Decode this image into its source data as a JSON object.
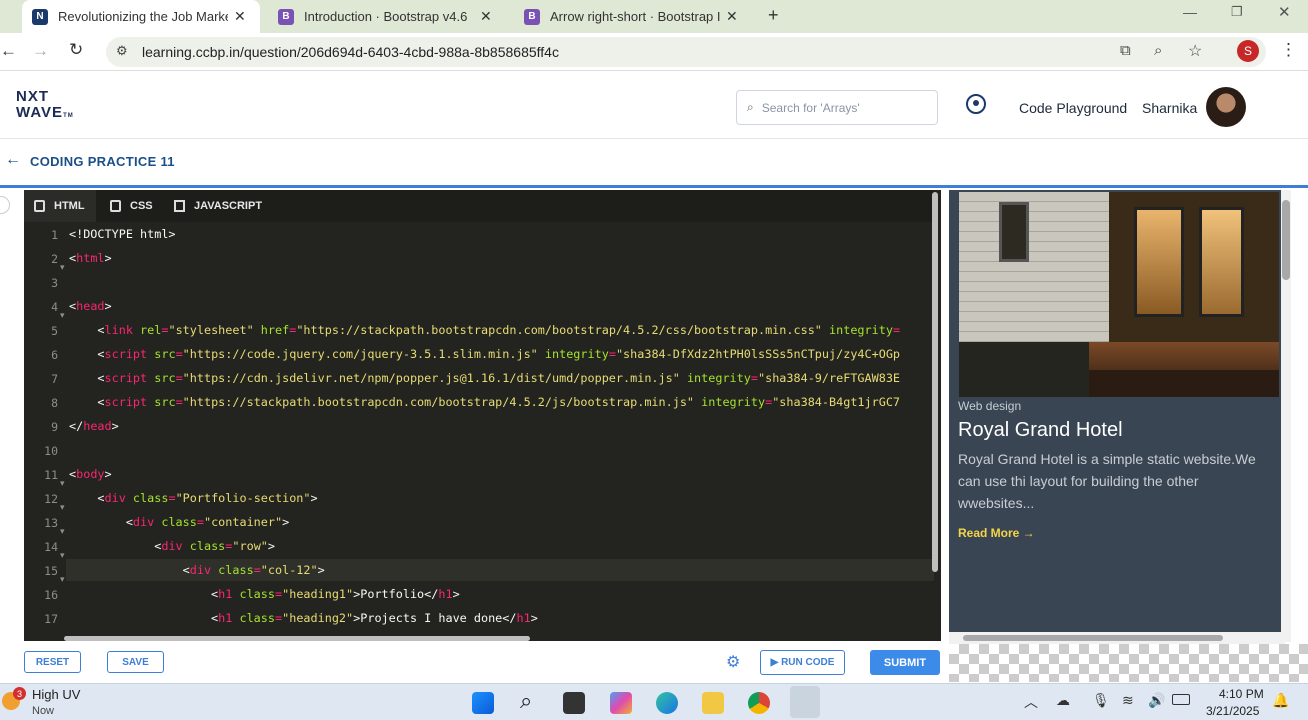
{
  "browser": {
    "tabs": [
      {
        "title": "Revolutionizing the Job Market",
        "active": true
      },
      {
        "title": "Introduction · Bootstrap v4.6",
        "active": false
      },
      {
        "title": "Arrow right-short · Bootstrap Ic",
        "active": false
      }
    ],
    "url": "learning.ccbp.in/question/206d694d-6403-4cbd-988a-8b858685ff4c",
    "profile_initial": "S"
  },
  "site": {
    "logo_line1": "NXT",
    "logo_line2": "WAVE",
    "logo_tm": "TM",
    "search_placeholder": "Search for 'Arrays'",
    "code_playground": "Code Playground",
    "username": "Sharnika"
  },
  "practice": {
    "title": "CODING PRACTICE 11"
  },
  "editor": {
    "tabs": [
      {
        "label": "HTML",
        "active": true
      },
      {
        "label": "CSS",
        "active": false
      },
      {
        "label": "JAVASCRIPT",
        "active": false
      }
    ],
    "line_numbers": [
      "1",
      "2",
      "3",
      "4",
      "5",
      "6",
      "7",
      "8",
      "9",
      "10",
      "11",
      "12",
      "13",
      "14",
      "15",
      "16",
      "17"
    ],
    "lines": {
      "l1": "<!DOCTYPE html>",
      "l2_open": "<",
      "l2_tag": "html",
      "l2_close": ">",
      "l4_open": "<",
      "l4_tag": "head",
      "l4_close": ">",
      "l5_a": "    <",
      "l5_tag": "link",
      "l5_attr1": " rel",
      "l5_eq1": "=",
      "l5_v1": "\"stylesheet\"",
      "l5_attr2": " href",
      "l5_eq2": "=",
      "l5_v2": "\"https://stackpath.bootstrapcdn.com/bootstrap/4.5.2/css/bootstrap.min.css\"",
      "l5_attr3": " integrity",
      "l5_eq3": "=",
      "l6_a": "    <",
      "l6_tag": "script",
      "l6_attr1": " src",
      "l6_eq1": "=",
      "l6_v1": "\"https://code.jquery.com/jquery-3.5.1.slim.min.js\"",
      "l6_attr2": " integrity",
      "l6_eq2": "=",
      "l6_v2": "\"sha384-DfXdz2htPH0lsSSs5nCTpuj/zy4C+OGp",
      "l7_a": "    <",
      "l7_tag": "script",
      "l7_attr1": " src",
      "l7_eq1": "=",
      "l7_v1": "\"https://cdn.jsdelivr.net/npm/popper.js@1.16.1/dist/umd/popper.min.js\"",
      "l7_attr2": " integrity",
      "l7_eq2": "=",
      "l7_v2": "\"sha384-9/reFTGAW83E",
      "l8_a": "    <",
      "l8_tag": "script",
      "l8_attr1": " src",
      "l8_eq1": "=",
      "l8_v1": "\"https://stackpath.bootstrapcdn.com/bootstrap/4.5.2/js/bootstrap.min.js\"",
      "l8_attr2": " integrity",
      "l8_eq2": "=",
      "l8_v2": "\"sha384-B4gt1jrGC7",
      "l9_open": "</",
      "l9_tag": "head",
      "l9_close": ">",
      "l11_open": "<",
      "l11_tag": "body",
      "l11_close": ">",
      "l12_a": "    <",
      "l12_tag": "div",
      "l12_attr": " class",
      "l12_eq": "=",
      "l12_v": "\"Portfolio-section\"",
      "l12_close": ">",
      "l13_a": "        <",
      "l13_tag": "div",
      "l13_attr": " class",
      "l13_eq": "=",
      "l13_v": "\"container\"",
      "l13_close": ">",
      "l14_a": "            <",
      "l14_tag": "div",
      "l14_attr": " class",
      "l14_eq": "=",
      "l14_v": "\"row\"",
      "l14_close": ">",
      "l15_a": "                <",
      "l15_tag": "div",
      "l15_attr": " class",
      "l15_eq": "=",
      "l15_v": "\"col-12\"",
      "l15_close": ">",
      "l16_a": "                    <",
      "l16_tag": "h1",
      "l16_attr": " class",
      "l16_eq": "=",
      "l16_v": "\"heading1\"",
      "l16_text": ">Portfolio</",
      "l16_tag2": "h1",
      "l16_close": ">",
      "l17_a": "                    <",
      "l17_tag": "h1",
      "l17_attr": " class",
      "l17_eq": "=",
      "l17_v": "\"heading2\"",
      "l17_text": ">Projects I have done</",
      "l17_tag2": "h1",
      "l17_close": ">"
    }
  },
  "preview": {
    "category": "Web design",
    "title": "Royal Grand Hotel",
    "description": "Royal Grand Hotel is a simple static website.We can use thi layout for building the other wwebsites...",
    "link": "Read More →"
  },
  "actions": {
    "reset": "RESET",
    "save": "SAVE",
    "run_code": "▶ RUN CODE",
    "submit": "SUBMIT"
  },
  "taskbar": {
    "notification_count": "3",
    "weather_title": "High UV",
    "weather_sub": "Now",
    "time": "4:10 PM",
    "date": "3/21/2025"
  },
  "colors": {
    "accent": "#3d7fd6",
    "editor_bg": "#23241f",
    "card_bg": "#3a4553",
    "link_yellow": "#f5d547"
  }
}
